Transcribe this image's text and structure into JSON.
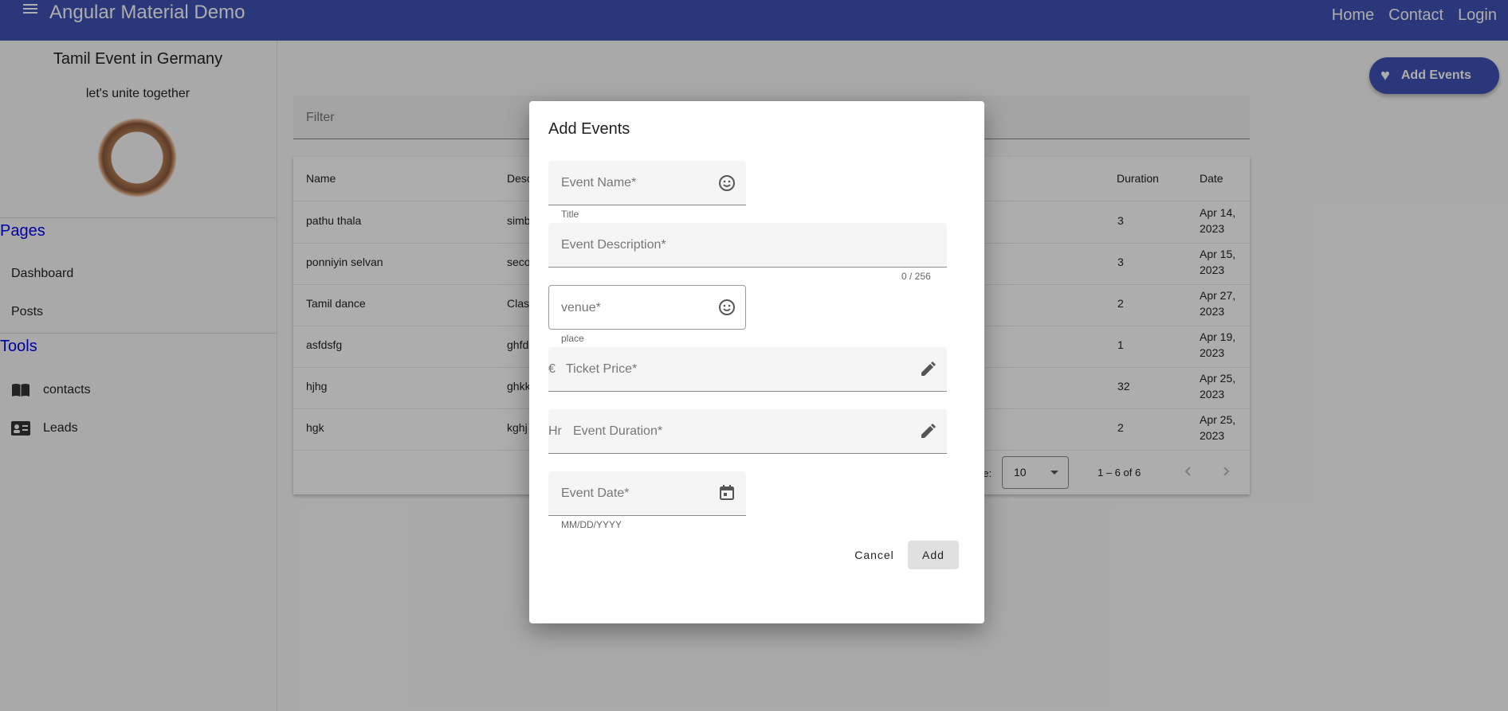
{
  "toolbar": {
    "title": "Angular Material Demo",
    "nav": [
      "Home",
      "Contact",
      "Login"
    ]
  },
  "sidenav": {
    "profile_name": "Tamil Event in Germany",
    "profile_tagline": "let's unite together",
    "sections": [
      {
        "title": "Pages",
        "items": [
          {
            "label": "Dashboard"
          },
          {
            "label": "Posts"
          }
        ]
      },
      {
        "title": "Tools",
        "items": [
          {
            "label": "contacts",
            "icon": "book-icon"
          },
          {
            "label": "Leads",
            "icon": "contact-card-icon"
          }
        ]
      }
    ]
  },
  "main": {
    "fab_label": "Add Events",
    "filter_label": "Filter",
    "table": {
      "headers": [
        "Name",
        "Desc",
        "Duration",
        "Date"
      ],
      "rows": [
        {
          "name": "pathu thala",
          "desc": "simb",
          "duration": "3",
          "date": [
            "Apr 14,",
            "2023"
          ]
        },
        {
          "name": "ponniyin selvan",
          "desc": "seco",
          "duration": "3",
          "date": [
            "Apr 15,",
            "2023"
          ]
        },
        {
          "name": "Tamil dance",
          "desc": "Clas",
          "duration": "2",
          "date": [
            "Apr 27,",
            "2023"
          ]
        },
        {
          "name": "asfdsfg",
          "desc": "ghfd",
          "duration": "1",
          "date": [
            "Apr 19,",
            "2023"
          ]
        },
        {
          "name": "hjhg",
          "desc": "ghkk",
          "duration": "32",
          "date": [
            "Apr 25,",
            "2023"
          ]
        },
        {
          "name": "hgk",
          "desc": "kghj",
          "duration": "2",
          "date": [
            "Apr 25,",
            "2023"
          ]
        }
      ],
      "paginator": {
        "items_per_page_label": "ge:",
        "page_size": "10",
        "range": "1 – 6 of 6"
      }
    }
  },
  "dialog": {
    "title": "Add Events",
    "fields": {
      "event_name": {
        "placeholder": "Event Name*",
        "hint": "Title",
        "icon": "smiley-icon"
      },
      "event_description": {
        "placeholder": "Event Description*",
        "counter": "0 / 256"
      },
      "venue": {
        "placeholder": "venue*",
        "hint": "place",
        "icon": "smiley-icon"
      },
      "ticket_price": {
        "prefix": "€",
        "placeholder": "Ticket Price*",
        "icon": "pencil-icon"
      },
      "event_duration": {
        "prefix": "Hr",
        "placeholder": "Event Duration*",
        "icon": "pencil-icon"
      },
      "event_date": {
        "placeholder": "Event Date*",
        "hint": "MM/DD/YYYY",
        "icon": "calendar-icon"
      }
    },
    "cancel_label": "Cancel",
    "add_label": "Add"
  }
}
